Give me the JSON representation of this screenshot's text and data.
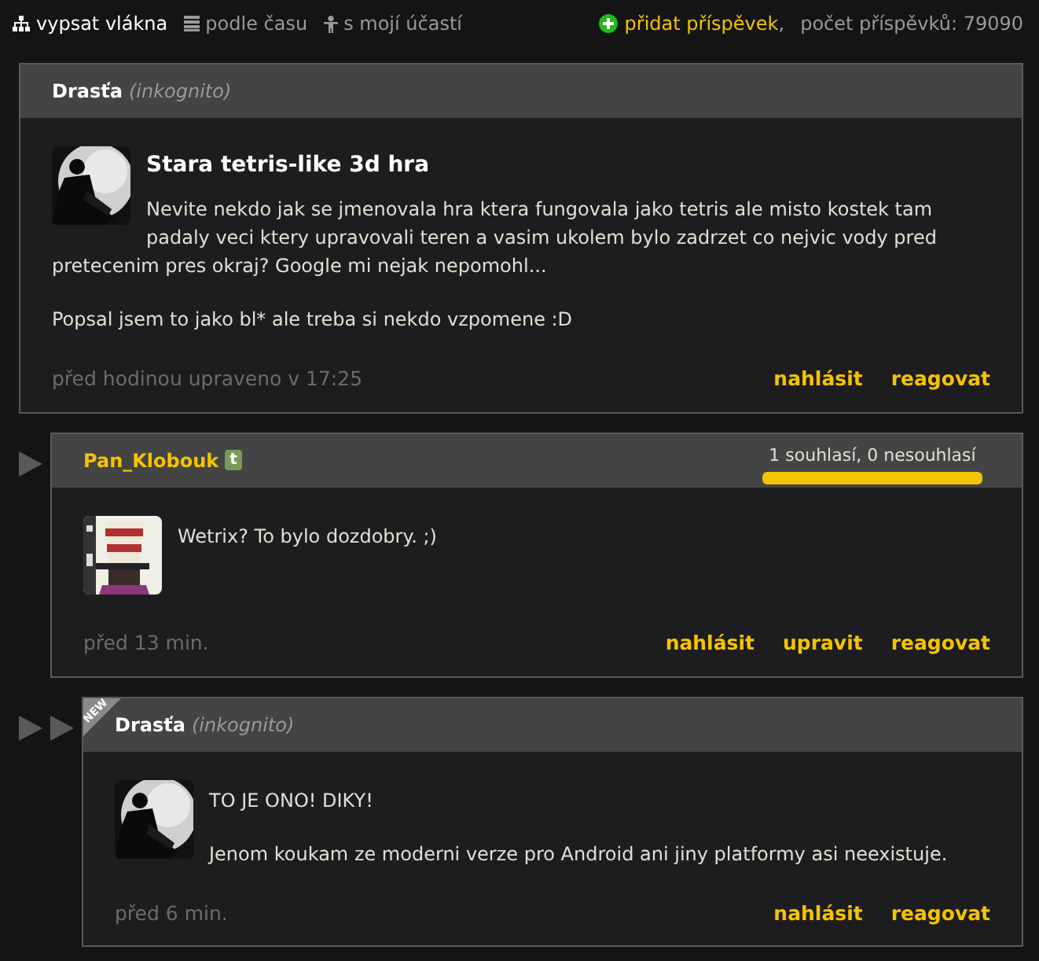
{
  "nav": {
    "items": [
      {
        "label": "vypsat vlákna",
        "selected": true
      },
      {
        "label": "podle času",
        "selected": false
      },
      {
        "label": "s mojí účastí",
        "selected": false
      }
    ],
    "add_post": "přidat příspěvek",
    "separator": ",",
    "post_count": "počet příspěvků: 79090"
  },
  "posts": [
    {
      "author": "Drasťa",
      "author_highlighted": false,
      "author_note": "(inkognito)",
      "new": false,
      "title": "Stara tetris-like 3d hra",
      "body": [
        "Nevite nekdo jak se jmenovala hra ktera fungovala jako tetris ale misto kostek tam padaly veci ktery upravovali teren a vasim ukolem bylo zadrzet co nejvic vody pred pretecenim pres okraj? Google mi nejak nepomohl...",
        "Popsal jsem to jako bl* ale treba si nekdo vzpomene :D"
      ],
      "time": "před hodinou upraveno v 17:25",
      "actions": [
        "nahlásit",
        "reagovat"
      ],
      "children": [
        {
          "author": "Pan_Klobouk",
          "author_highlighted": true,
          "badge": "t",
          "new": false,
          "agreement": {
            "text": "1 souhlasí, 0 nesouhlasí",
            "level": 1
          },
          "body": [
            "Wetrix? To bylo dozdobry. ;)"
          ],
          "time": "před 13 min.",
          "actions": [
            "nahlásit",
            "upravit",
            "reagovat"
          ],
          "children": [
            {
              "author": "Drasťa",
              "author_highlighted": false,
              "author_note": "(inkognito)",
              "new": true,
              "new_label": "NEW",
              "body": [
                "TO JE ONO! DIKY!",
                "Jenom koukam ze moderni verze pro Android ani jiny platformy asi neexistuje."
              ],
              "time": "před 6 min.",
              "actions": [
                "nahlásit",
                "reagovat"
              ]
            }
          ]
        }
      ]
    }
  ]
}
